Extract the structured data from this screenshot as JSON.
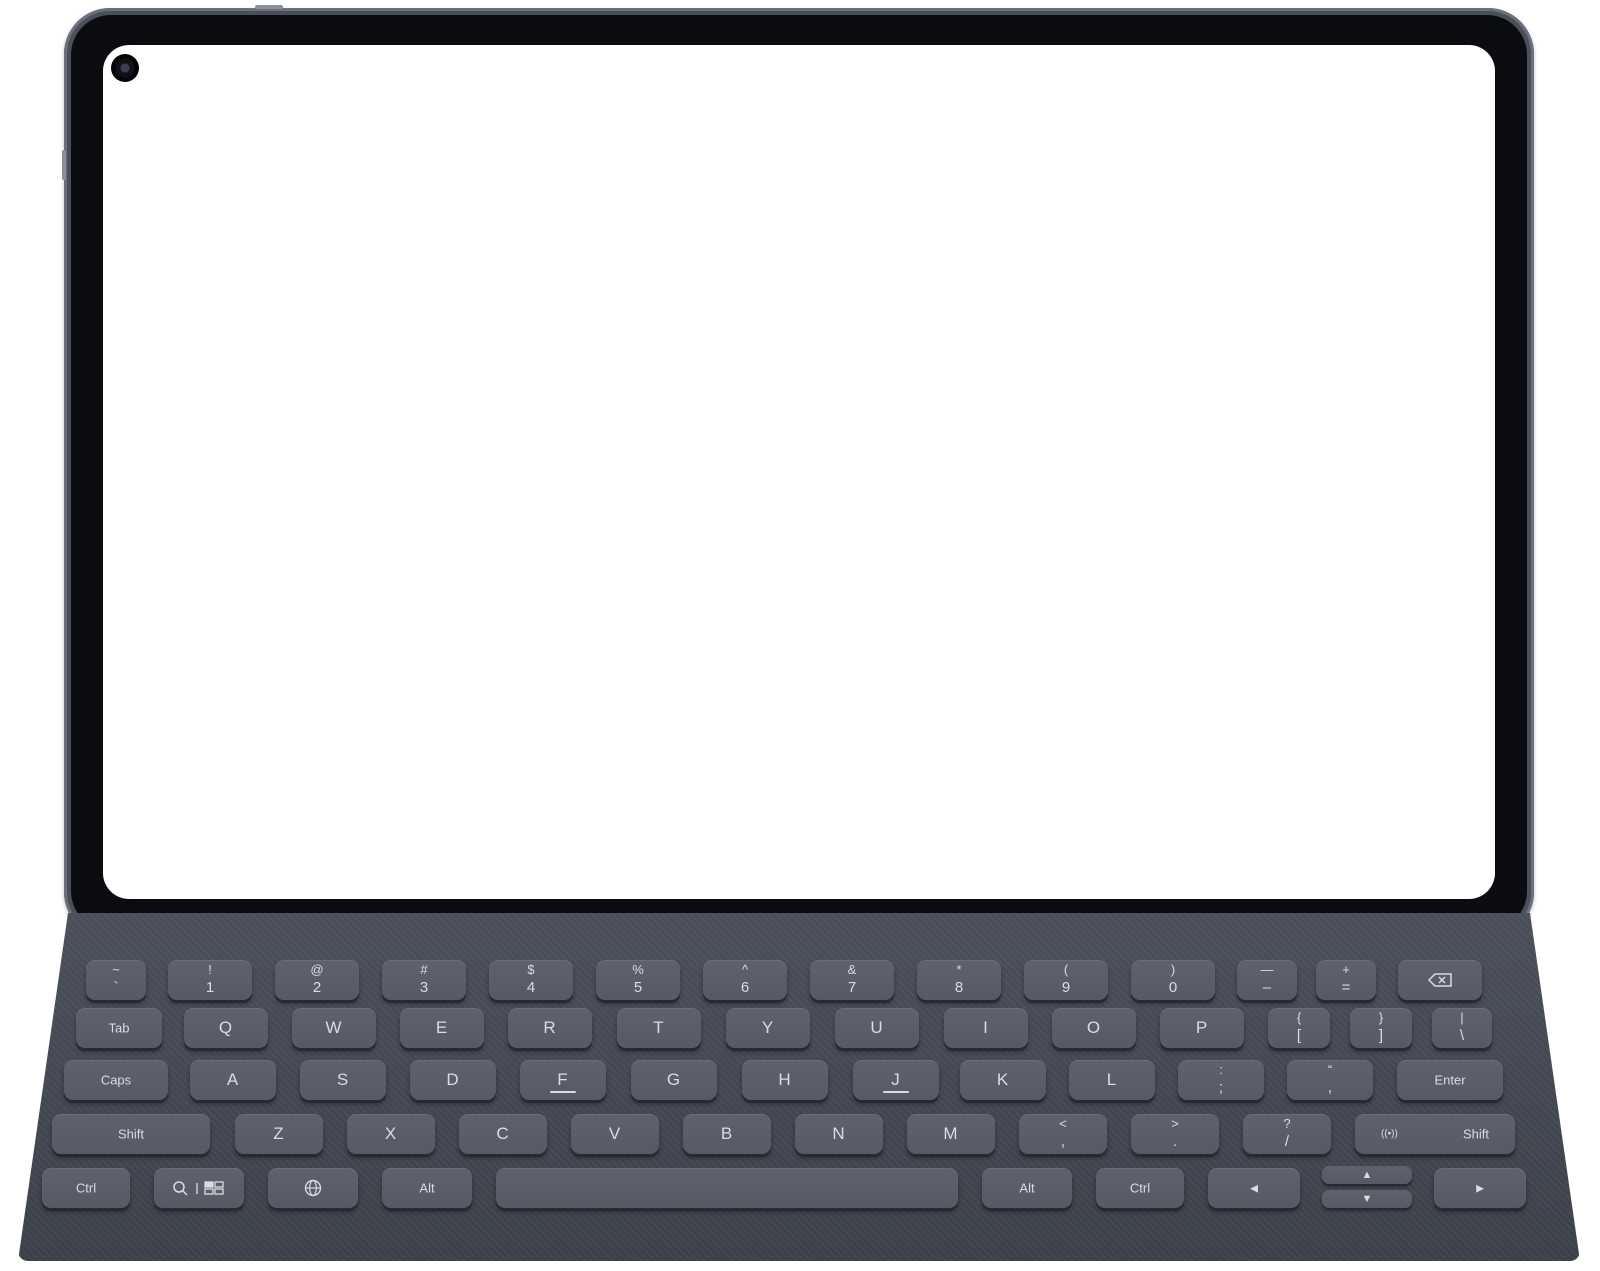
{
  "keyboard": {
    "row1": [
      {
        "top": "~",
        "bot": "`"
      },
      {
        "top": "!",
        "bot": "1"
      },
      {
        "top": "@",
        "bot": "2"
      },
      {
        "top": "#",
        "bot": "3"
      },
      {
        "top": "$",
        "bot": "4"
      },
      {
        "top": "%",
        "bot": "5"
      },
      {
        "top": "^",
        "bot": "6"
      },
      {
        "top": "&",
        "bot": "7"
      },
      {
        "top": "*",
        "bot": "8"
      },
      {
        "top": "(",
        "bot": "9"
      },
      {
        "top": ")",
        "bot": "0"
      },
      {
        "top": "—",
        "bot": "–"
      },
      {
        "top": "+",
        "bot": "="
      }
    ],
    "row2": {
      "tab": "Tab",
      "letters": [
        "Q",
        "W",
        "E",
        "R",
        "T",
        "Y",
        "U",
        "I",
        "O",
        "P"
      ],
      "brackets": [
        {
          "top": "{",
          "bot": "["
        },
        {
          "top": "}",
          "bot": "]"
        },
        {
          "top": "|",
          "bot": "\\"
        }
      ]
    },
    "row3": {
      "caps": "Caps",
      "letters": [
        "A",
        "S",
        "D",
        "F",
        "G",
        "H",
        "J",
        "K",
        "L"
      ],
      "punct": [
        {
          "top": ":",
          "bot": ";"
        },
        {
          "top": "“",
          "bot": ","
        }
      ],
      "enter": "Enter"
    },
    "row4": {
      "shift_left": "Shift",
      "letters": [
        "Z",
        "X",
        "C",
        "V",
        "B",
        "N",
        "M"
      ],
      "punct": [
        {
          "top": "<",
          "bot": ","
        },
        {
          "top": ">",
          "bot": "."
        },
        {
          "top": "?",
          "bot": "/"
        }
      ],
      "wireless": "((•))",
      "shift_right": "Shift"
    },
    "row5": {
      "ctrl_left": "Ctrl",
      "alt_left": "Alt",
      "alt_right": "Alt",
      "ctrl_right": "Ctrl",
      "arrow_left": "◄",
      "arrow_up": "▲",
      "arrow_down": "▼",
      "arrow_right": "►"
    }
  },
  "icons": [
    "front-camera-icon",
    "backspace-icon",
    "search-icon",
    "multitask-icon",
    "globe-icon"
  ]
}
